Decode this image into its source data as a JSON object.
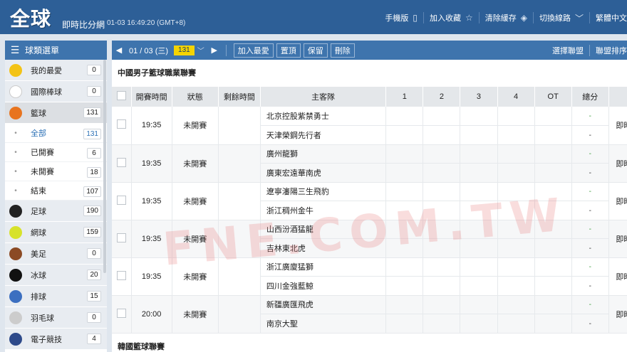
{
  "header": {
    "logo": "全球",
    "subtitle": "即時比分網",
    "datetime": "01-03 16:49:20 (GMT+8)",
    "nav": [
      {
        "label": "手機版",
        "icon": "phone-icon"
      },
      {
        "label": "加入收藏",
        "icon": "star-icon"
      },
      {
        "label": "清除緩存",
        "icon": "eraser-icon"
      },
      {
        "label": "切換線路",
        "icon": "chevron-down-icon"
      },
      {
        "label": "繁體中文",
        "icon": ""
      }
    ]
  },
  "sidebar": {
    "title": "球類選單",
    "items": [
      {
        "label": "我的最愛",
        "count": "0",
        "icon": "star-icon",
        "color": "#f3c316"
      },
      {
        "label": "國際棒球",
        "count": "0",
        "icon": "baseball-bat-icon",
        "color": "#ffffff"
      },
      {
        "label": "籃球",
        "count": "131",
        "icon": "basketball-icon",
        "color": "#e8741f"
      },
      {
        "label": "全部",
        "count": "131",
        "sub": true,
        "active": true
      },
      {
        "label": "已開賽",
        "count": "6",
        "sub": true
      },
      {
        "label": "未開賽",
        "count": "18",
        "sub": true
      },
      {
        "label": "結束",
        "count": "107",
        "sub": true
      },
      {
        "label": "足球",
        "count": "190",
        "icon": "soccer-ball-icon",
        "color": "#222222"
      },
      {
        "label": "網球",
        "count": "159",
        "icon": "tennis-ball-icon",
        "color": "#d7e22a"
      },
      {
        "label": "美足",
        "count": "0",
        "icon": "american-football-icon",
        "color": "#8b4a24"
      },
      {
        "label": "冰球",
        "count": "20",
        "icon": "hockey-puck-icon",
        "color": "#111111"
      },
      {
        "label": "排球",
        "count": "15",
        "icon": "volleyball-icon",
        "color": "#3c6fc0"
      },
      {
        "label": "羽毛球",
        "count": "0",
        "icon": "shuttlecock-icon",
        "color": "#cccccc"
      },
      {
        "label": "電子競技",
        "count": "4",
        "icon": "gamepad-icon",
        "color": "#2e4a8a"
      }
    ]
  },
  "toolbar": {
    "date": "01 / 03 (三)",
    "badge": "131",
    "buttons": [
      "加入最愛",
      "置頂",
      "保留",
      "刪除"
    ],
    "right": [
      "選擇聯盟",
      "聯盟排序"
    ]
  },
  "league": {
    "name": "中國男子籃球職業聯賽",
    "columns": [
      "開賽時間",
      "狀態",
      "剩餘時間",
      "主客隊",
      "1",
      "2",
      "3",
      "4",
      "OT",
      "總分",
      ""
    ],
    "games": [
      {
        "time": "19:35",
        "status": "未開賽",
        "home": "北京控股紫禁勇士",
        "away": "天津榮鋼先行者",
        "extra": "即時"
      },
      {
        "time": "19:35",
        "status": "未開賽",
        "home": "廣州龍獅",
        "away": "廣東宏遠華南虎",
        "extra": "即時"
      },
      {
        "time": "19:35",
        "status": "未開賽",
        "home": "遼寧瀋陽三生飛豹",
        "away": "浙江稠州金牛",
        "extra": "即時"
      },
      {
        "time": "19:35",
        "status": "未開賽",
        "home": "山西汾酒猛龍",
        "away": "吉林東北虎",
        "extra": "即時"
      },
      {
        "time": "19:35",
        "status": "未開賽",
        "home": "浙江廣廈猛獅",
        "away": "四川金強藍鯨",
        "extra": "即時"
      },
      {
        "time": "20:00",
        "status": "未開賽",
        "home": "新疆廣匯飛虎",
        "away": "南京大聖",
        "extra": "即時"
      }
    ],
    "dash": "-"
  },
  "next_league": "韓國籃球聯賽",
  "watermark": "FNE.COM.TW"
}
